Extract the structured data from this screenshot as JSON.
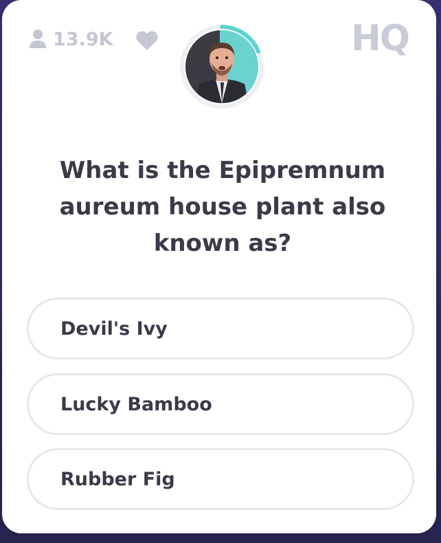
{
  "header": {
    "viewer_count": "13.9K",
    "logo_text": "HQ",
    "icons": [
      "person-icon",
      "heart-icon"
    ],
    "timer_color": "#5fd3cf"
  },
  "question": {
    "text": "What is the Epipremnum aureum house plant also known as?"
  },
  "answers": [
    {
      "label": "Devil's Ivy"
    },
    {
      "label": "Lucky Bamboo"
    },
    {
      "label": "Rubber Fig"
    }
  ],
  "colors": {
    "card": "#ffffff",
    "background": "#2f2a55",
    "muted": "#c4c6d3",
    "text": "#3a3a4a",
    "answer_border": "#e6e7ec"
  }
}
